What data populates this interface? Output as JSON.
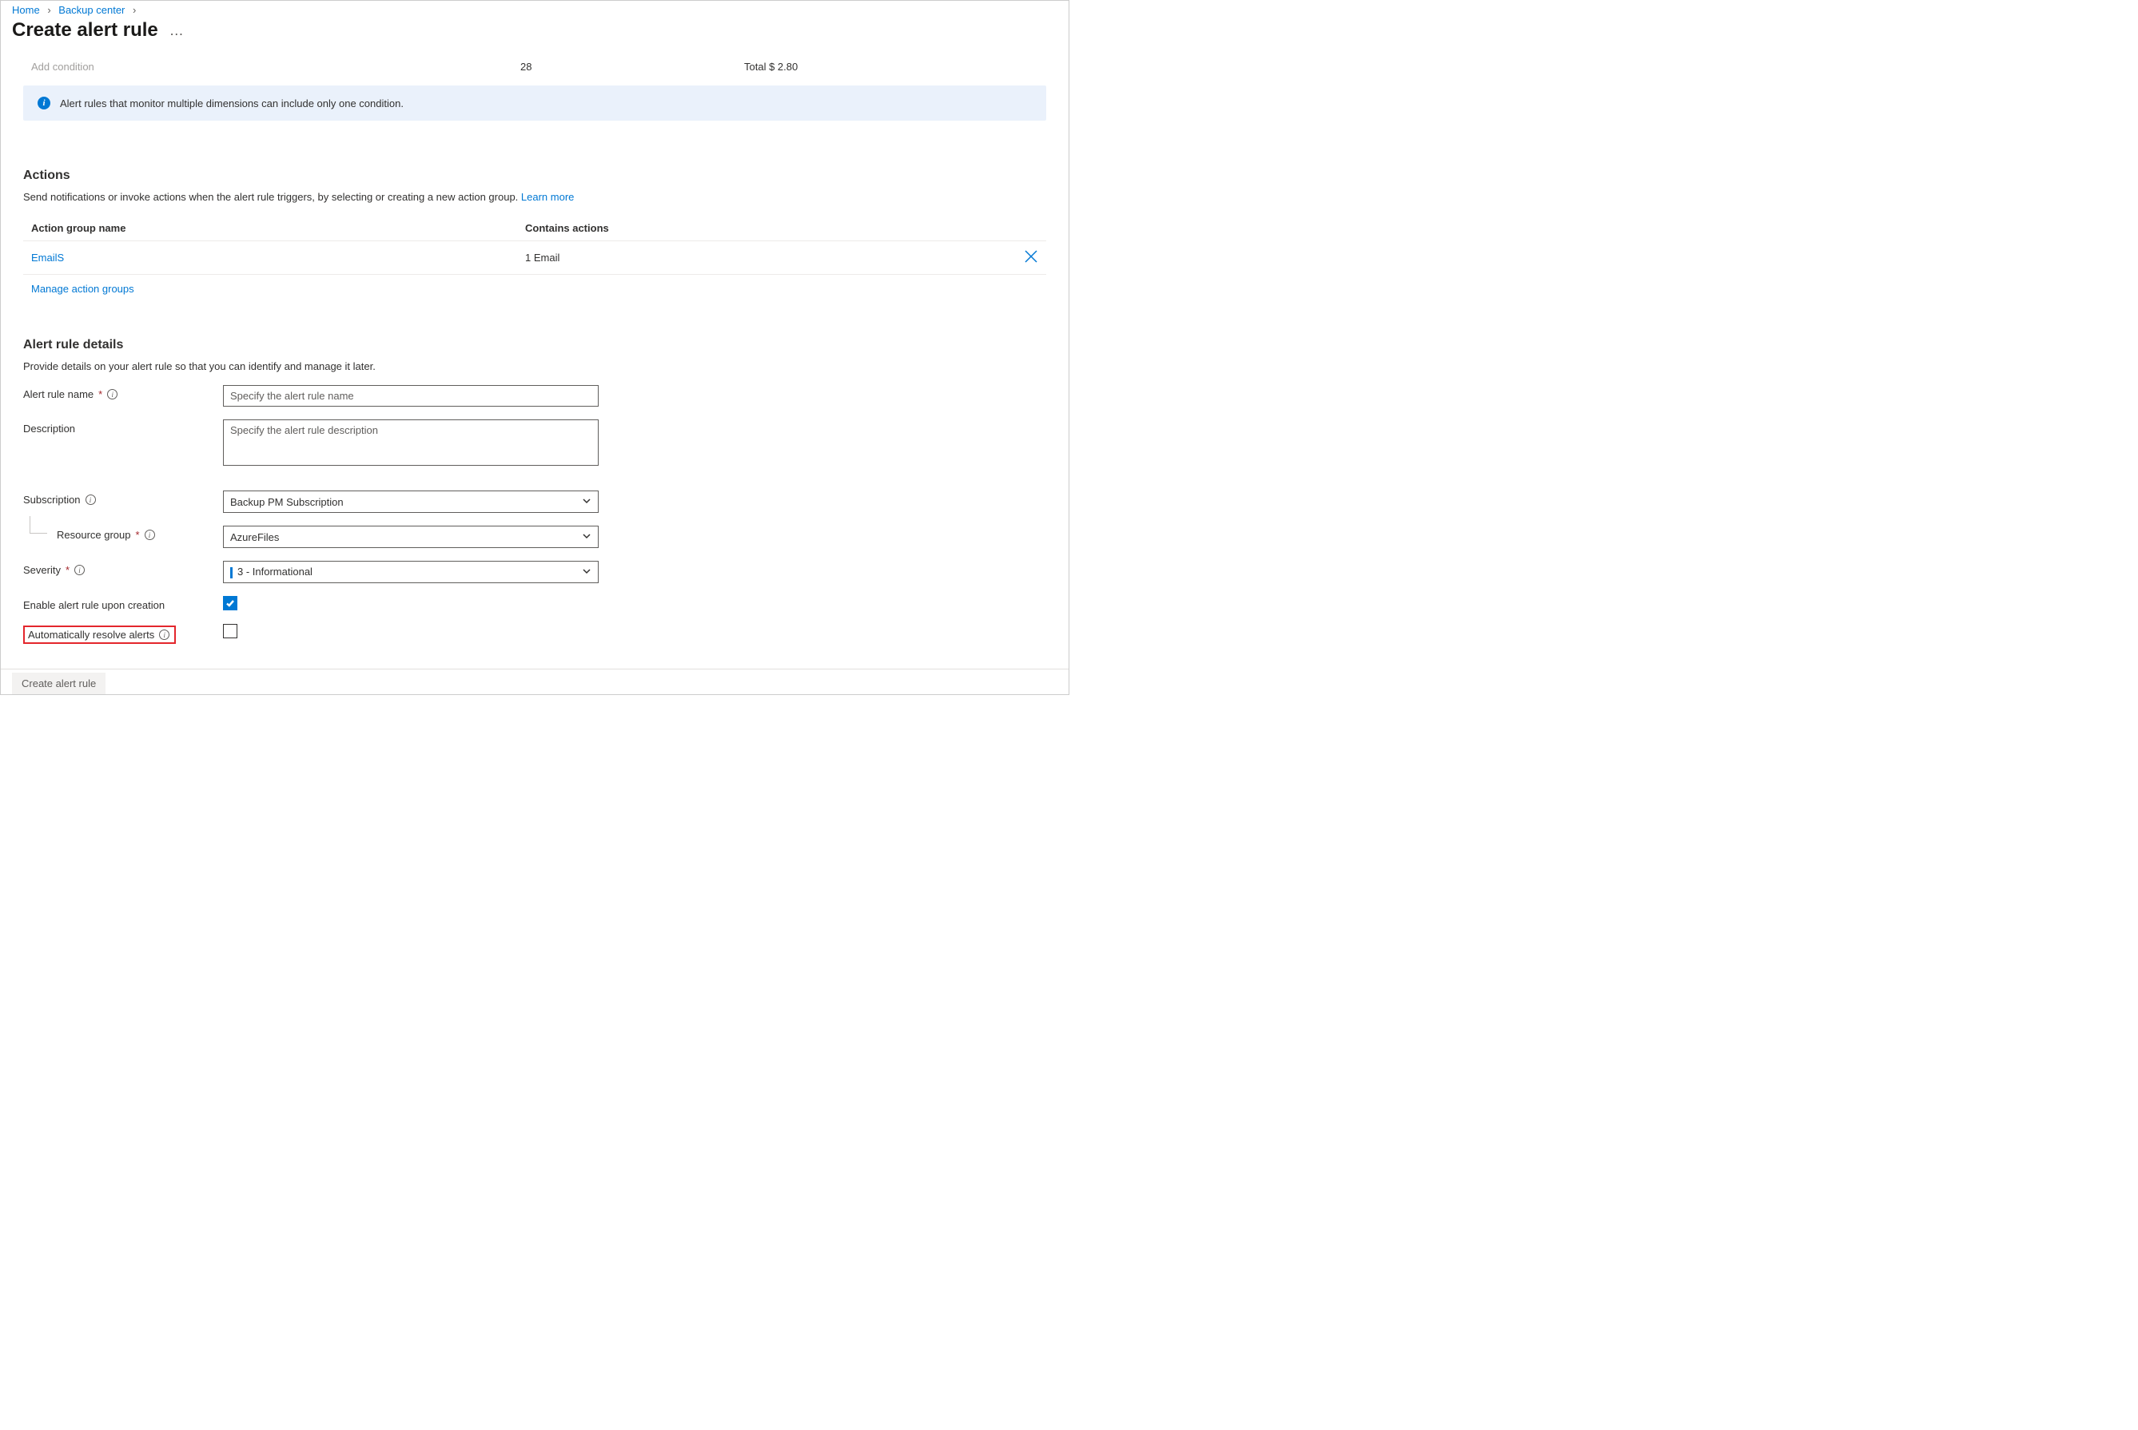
{
  "breadcrumb": {
    "home": "Home",
    "backup_center": "Backup center"
  },
  "page_title": "Create alert rule",
  "condition_bar": {
    "add_condition": "Add condition",
    "count": "28",
    "total": "Total $ 2.80"
  },
  "info_banner": "Alert rules that monitor multiple dimensions can include only one condition.",
  "actions": {
    "title": "Actions",
    "desc": "Send notifications or invoke actions when the alert rule triggers, by selecting or creating a new action group. ",
    "learn_more": "Learn more",
    "header_name": "Action group name",
    "header_contains": "Contains actions",
    "rows": [
      {
        "name": "EmailS",
        "contains": "1 Email"
      }
    ],
    "manage": "Manage action groups"
  },
  "details": {
    "title": "Alert rule details",
    "desc": "Provide details on your alert rule so that you can identify and manage it later.",
    "name_label": "Alert rule name",
    "name_placeholder": "Specify the alert rule name",
    "desc_label": "Description",
    "desc_placeholder": "Specify the alert rule description",
    "subscription_label": "Subscription",
    "subscription_value": "Backup PM Subscription",
    "rg_label": "Resource group",
    "rg_value": "AzureFiles",
    "severity_label": "Severity",
    "severity_value": "3 - Informational",
    "enable_label": "Enable alert rule upon creation",
    "auto_resolve_label": "Automatically resolve alerts"
  },
  "footer": {
    "create_button": "Create alert rule"
  }
}
